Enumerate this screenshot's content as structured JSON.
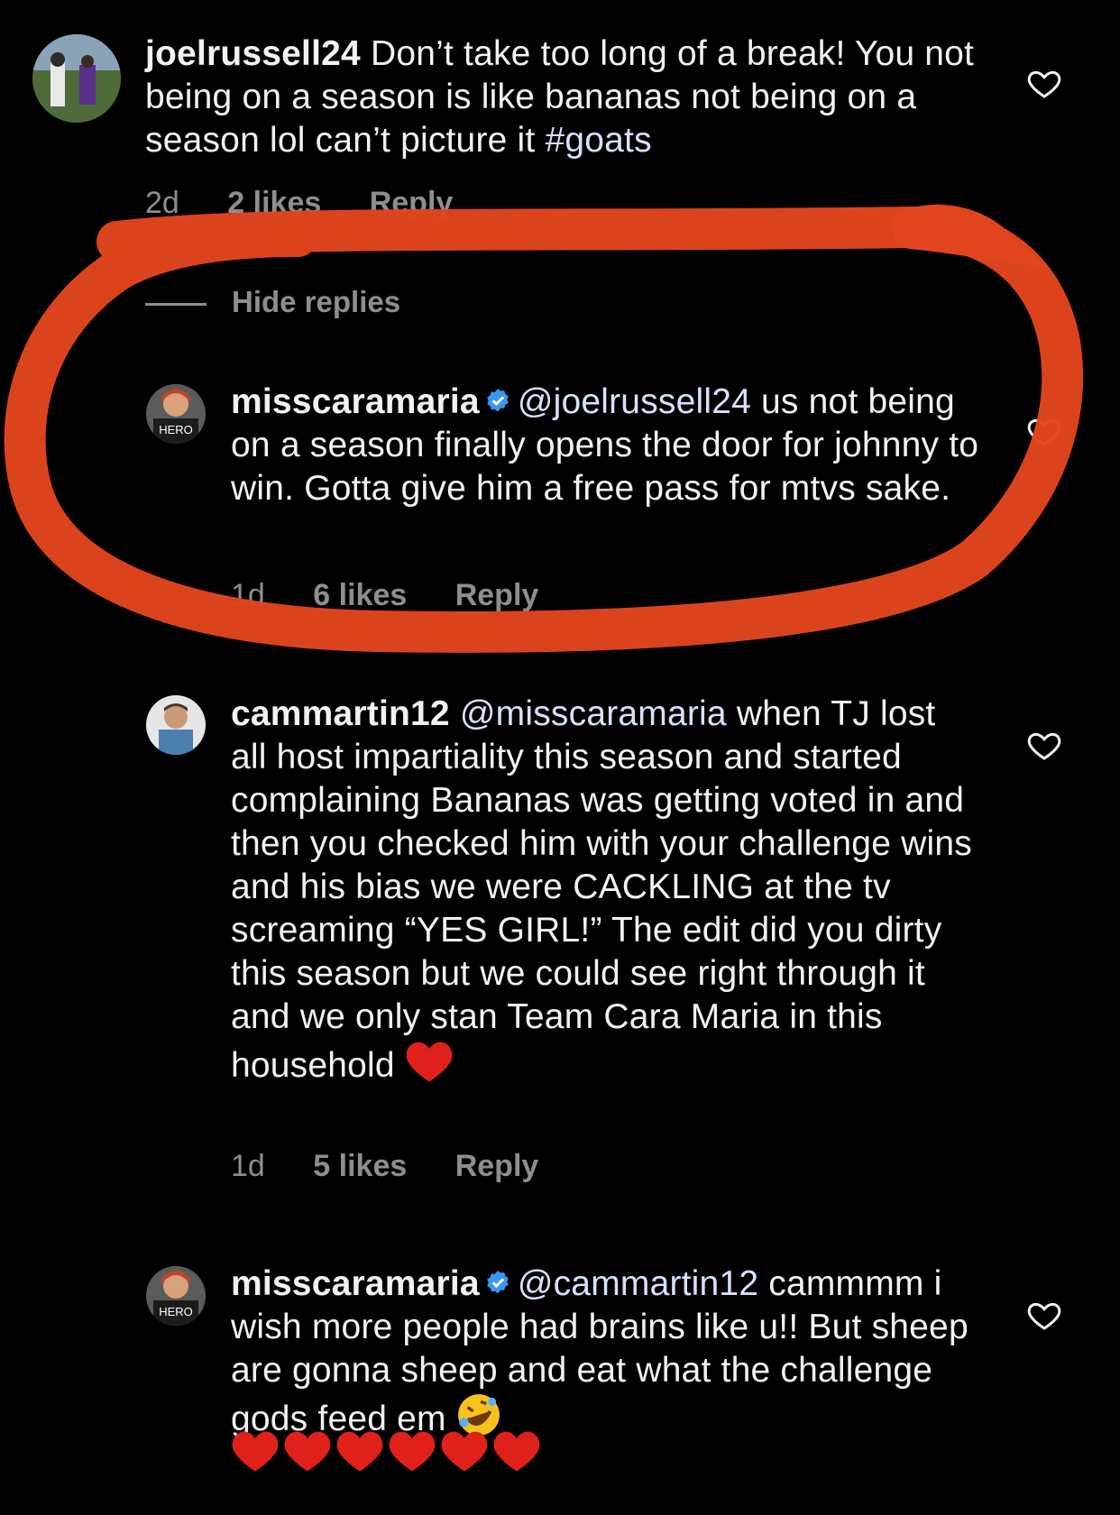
{
  "colors": {
    "background": "#000000",
    "text": "#f2f2f2",
    "muted": "#8e8e8e",
    "mention": "#d6e2ff",
    "verified": "#3897f0",
    "scribble": "#e2451e",
    "emoji_heart": "#e0201a"
  },
  "comments": [
    {
      "username": "joelrussell24",
      "verified": false,
      "mention": "",
      "text": "Don’t take too long of a break! You not being on a season is like bananas not being on a season lol  can’t picture it ",
      "hashtag": "#goats",
      "time": "2d",
      "likes": "2 likes",
      "reply": "Reply",
      "avatar_icon": "photo-avatar-icon"
    },
    {
      "username": "misscaramaria",
      "verified": true,
      "mention": "@joelrussell24",
      "text": " us not being on a season finally opens the door for johnny to win. Gotta give him a free pass for mtvs sake.",
      "time": "1d",
      "likes": "6 likes",
      "reply": "Reply",
      "avatar_icon": "photo-avatar-icon",
      "avatar_badge": "HERO"
    },
    {
      "username": "cammartin12",
      "verified": false,
      "mention": "@misscaramaria",
      "text": " when TJ lost all host impartiality this season and started complaining Bananas was getting voted in and then you checked him with your challenge wins and his bias we were CACKLING at the tv screaming “YES GIRL!” The edit did you dirty this season but we could see right through it and we only stan Team Cara Maria in this household ",
      "emoji": "heart-emoji",
      "time": "1d",
      "likes": "5 likes",
      "reply": "Reply",
      "avatar_icon": "photo-avatar-icon"
    },
    {
      "username": "misscaramaria",
      "verified": true,
      "mention": "@cammartin12",
      "text": " cammmm i wish more people had brains like u!! But sheep are gonna sheep and eat what the challenge gods feed em ",
      "emoji": "rofl-emoji",
      "hearts_count": 6,
      "avatar_icon": "photo-avatar-icon",
      "avatar_badge": "HERO"
    }
  ],
  "hide_replies": "Hide replies"
}
